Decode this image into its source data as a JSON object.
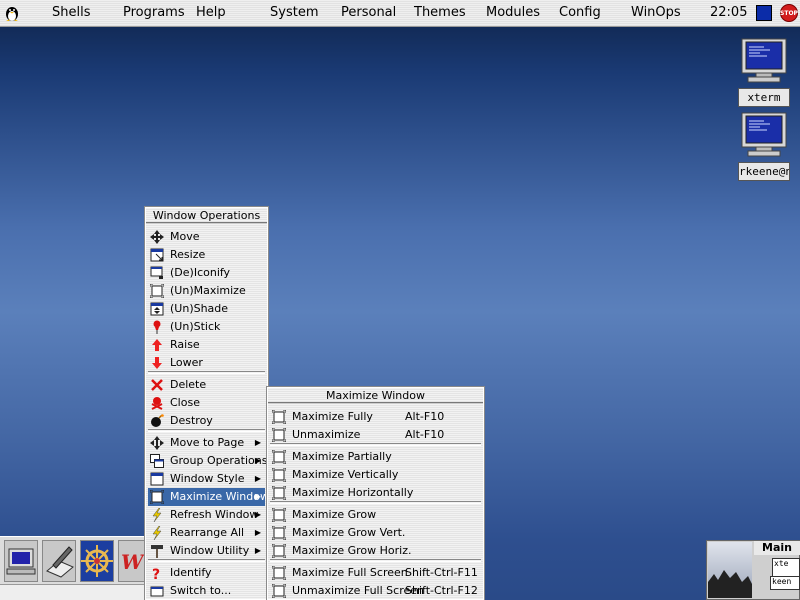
{
  "menubar": {
    "items": [
      "Shells",
      "Programs",
      "Help",
      "System",
      "Personal",
      "Themes",
      "Modules",
      "Config",
      "WinOps"
    ],
    "clock": "22:05",
    "stop_label": "STOP"
  },
  "desktop_icons": [
    {
      "label": "xterm"
    },
    {
      "label": "rkeene@n"
    }
  ],
  "window_ops_menu": {
    "title": "Window Operations",
    "items": [
      {
        "label": "Move",
        "icon": "move-icon"
      },
      {
        "label": "Resize",
        "icon": "resize-icon"
      },
      {
        "label": "(De)Iconify",
        "icon": "iconify-icon"
      },
      {
        "label": "(Un)Maximize",
        "icon": "maximize-icon"
      },
      {
        "label": "(Un)Shade",
        "icon": "shade-icon"
      },
      {
        "label": "(Un)Stick",
        "icon": "pin-icon"
      },
      {
        "label": "Raise",
        "icon": "raise-icon"
      },
      {
        "label": "Lower",
        "icon": "lower-icon"
      },
      {
        "label": "Delete",
        "icon": "delete-icon"
      },
      {
        "label": "Close",
        "icon": "close-icon"
      },
      {
        "label": "Destroy",
        "icon": "bomb-icon"
      },
      {
        "label": "Move to Page",
        "icon": "move-page-icon",
        "submenu": true
      },
      {
        "label": "Group Operations",
        "icon": "group-icon",
        "submenu": true
      },
      {
        "label": "Window Style",
        "icon": "window-style-icon",
        "submenu": true
      },
      {
        "label": "Maximize Window",
        "icon": "maximize-window-icon",
        "submenu": true,
        "selected": true
      },
      {
        "label": "Refresh Window",
        "icon": "lightning-icon",
        "submenu": true
      },
      {
        "label": "Rearrange All",
        "icon": "lightning-icon",
        "submenu": true
      },
      {
        "label": "Window Utility",
        "icon": "hammer-icon",
        "submenu": true
      },
      {
        "label": "Identify",
        "icon": "question-icon"
      },
      {
        "label": "Switch to...",
        "icon": "switch-icon"
      }
    ]
  },
  "maximize_menu": {
    "title": "Maximize Window",
    "items": [
      {
        "label": "Maximize Fully",
        "accel": "Alt-F10"
      },
      {
        "label": "Unmaximize",
        "accel": "Alt-F10"
      },
      {
        "label": "Maximize Partially",
        "accel": ""
      },
      {
        "label": "Maximize Vertically",
        "accel": ""
      },
      {
        "label": "Maximize Horizontally",
        "accel": ""
      },
      {
        "label": "Maximize Grow",
        "accel": ""
      },
      {
        "label": "Maximize Grow Vert.",
        "accel": ""
      },
      {
        "label": "Maximize Grow Horiz.",
        "accel": ""
      },
      {
        "label": "Maximize Full Screen",
        "accel": "Shift-Ctrl-F11"
      },
      {
        "label": "Unmaximize Full Screen",
        "accel": "Shift-Ctrl-F12"
      }
    ]
  },
  "pager": {
    "title": "Main",
    "windows": [
      "xte",
      "keen"
    ]
  },
  "colors": {
    "selection": "#3a68a8",
    "desktop_top": "#0e2247",
    "desktop_mid": "#5b80bb"
  }
}
